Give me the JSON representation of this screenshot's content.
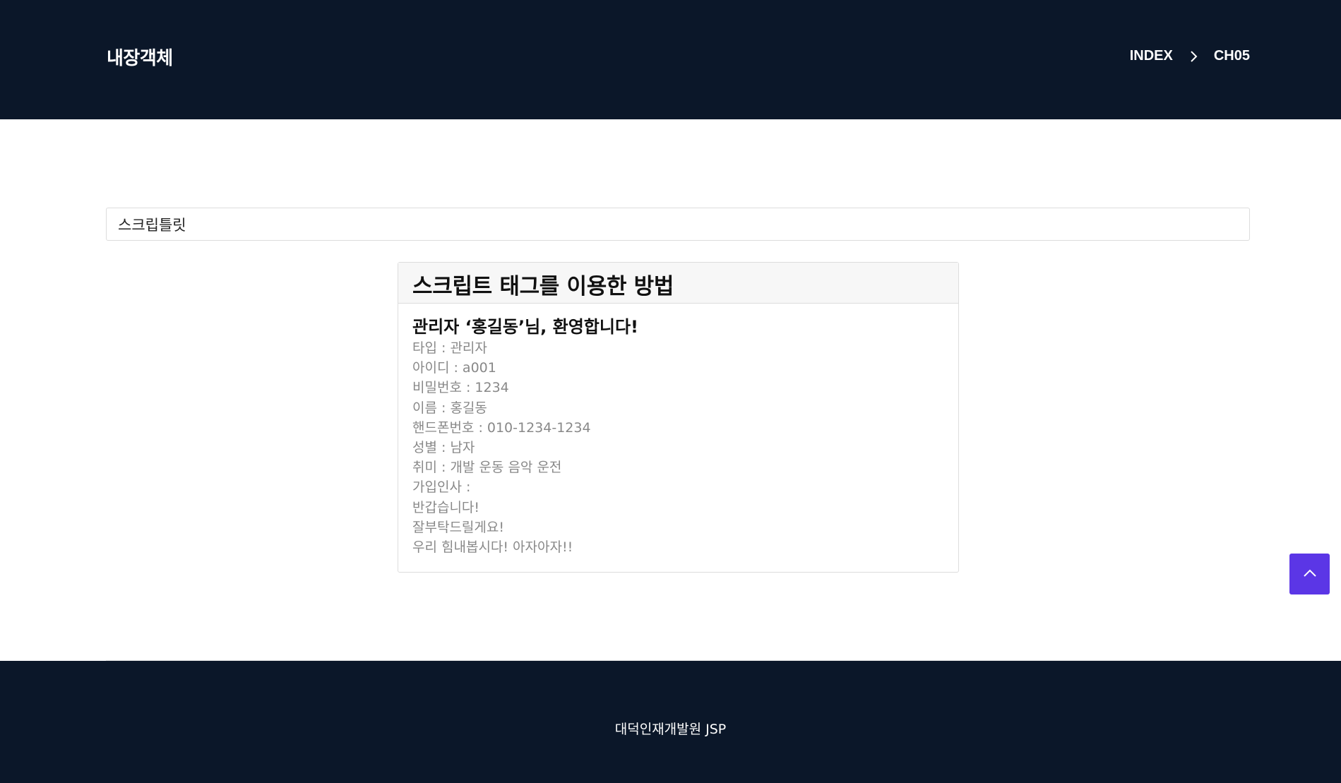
{
  "header": {
    "site_title": "내장객체",
    "breadcrumb": [
      {
        "label": "INDEX"
      },
      {
        "label": "CH05"
      }
    ]
  },
  "section": {
    "input_value": "스크립틀릿"
  },
  "card": {
    "title": "스크립트 태그를 이용한 방법",
    "welcome": "관리자 ‘홍길동’님, 환영합니다!",
    "lines": [
      "타입 : 관리자",
      "아이디 : a001",
      "비밀번호 : 1234",
      "이름 : 홍길동",
      "핸드폰번호 : 010-1234-1234",
      "성별 : 남자",
      "취미 : 개발 운동 음악 운전",
      "가입인사 :",
      "반갑습니다!",
      "잘부탁드릴게요!",
      "우리 힘내봅시다! 아자아자!!"
    ]
  },
  "scroll_top": {
    "icon": "chevron-up-icon",
    "color": "#5b36e6"
  },
  "footer": {
    "text": "대덕인재개발원 JSP"
  },
  "colors": {
    "header_bg": "#0b1729",
    "footer_bg": "#0b1729",
    "accent": "#5b36e6"
  }
}
